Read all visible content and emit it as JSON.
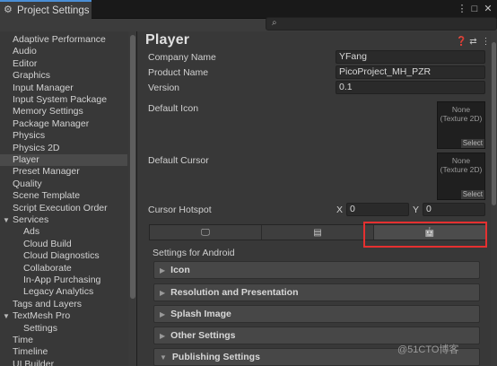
{
  "window": {
    "title": "Project Settings",
    "controls": [
      "⋮",
      "□",
      "✕"
    ]
  },
  "search": {
    "placeholder": ""
  },
  "sidebar": {
    "items": [
      {
        "label": "Adaptive Performance",
        "indent": 0
      },
      {
        "label": "Audio",
        "indent": 0
      },
      {
        "label": "Editor",
        "indent": 0
      },
      {
        "label": "Graphics",
        "indent": 0
      },
      {
        "label": "Input Manager",
        "indent": 0
      },
      {
        "label": "Input System Package",
        "indent": 0
      },
      {
        "label": "Memory Settings",
        "indent": 0
      },
      {
        "label": "Package Manager",
        "indent": 0
      },
      {
        "label": "Physics",
        "indent": 0
      },
      {
        "label": "Physics 2D",
        "indent": 0
      },
      {
        "label": "Player",
        "indent": 0,
        "selected": true
      },
      {
        "label": "Preset Manager",
        "indent": 0
      },
      {
        "label": "Quality",
        "indent": 0
      },
      {
        "label": "Scene Template",
        "indent": 0
      },
      {
        "label": "Script Execution Order",
        "indent": 0
      },
      {
        "label": "Services",
        "indent": 0,
        "expandable": true
      },
      {
        "label": "Ads",
        "indent": 2
      },
      {
        "label": "Cloud Build",
        "indent": 2
      },
      {
        "label": "Cloud Diagnostics",
        "indent": 2
      },
      {
        "label": "Collaborate",
        "indent": 2
      },
      {
        "label": "In-App Purchasing",
        "indent": 2
      },
      {
        "label": "Legacy Analytics",
        "indent": 2
      },
      {
        "label": "Tags and Layers",
        "indent": 0
      },
      {
        "label": "TextMesh Pro",
        "indent": 0,
        "expandable": true
      },
      {
        "label": "Settings",
        "indent": 2
      },
      {
        "label": "Time",
        "indent": 0
      },
      {
        "label": "Timeline",
        "indent": 0
      },
      {
        "label": "UI Builder",
        "indent": 0
      }
    ]
  },
  "main": {
    "title": "Player",
    "header_icons": [
      "help-icon",
      "preset-icon",
      "more-icon"
    ],
    "company_label": "Company Name",
    "company_value": "YFang",
    "product_label": "Product Name",
    "product_value": "PicoProject_MH_PZR",
    "version_label": "Version",
    "version_value": "0.1",
    "default_icon_label": "Default Icon",
    "default_cursor_label": "Default Cursor",
    "texture_none": "None",
    "texture_type": "(Texture 2D)",
    "texture_select": "Select",
    "hotspot_label": "Cursor Hotspot",
    "hotspot_x_label": "X",
    "hotspot_x": "0",
    "hotspot_y_label": "Y",
    "hotspot_y": "0",
    "platform_tabs": [
      {
        "icon": "monitor-icon",
        "glyph": "🖵"
      },
      {
        "icon": "server-icon",
        "glyph": "▤"
      },
      {
        "icon": "android-icon",
        "glyph": "🤖",
        "active": true
      }
    ],
    "settings_for": "Settings for Android",
    "sections": [
      "Icon",
      "Resolution and Presentation",
      "Splash Image",
      "Other Settings",
      "Publishing Settings"
    ]
  },
  "watermark": "@51CTO博客",
  "colors": {
    "highlight": "#e53030",
    "tab_accent": "#4a8ed6"
  }
}
